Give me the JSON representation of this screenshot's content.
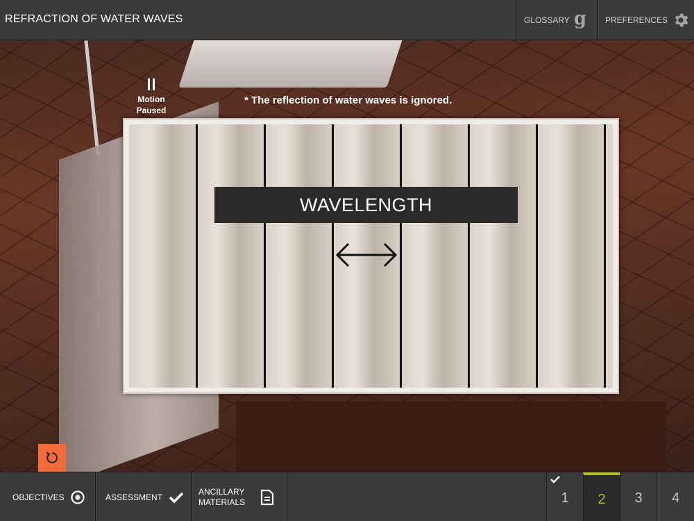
{
  "header": {
    "title": "REFRACTION OF WATER WAVES",
    "glossary_label": "GLOSSARY",
    "glossary_glyph": "g",
    "preferences_label": "PREFERENCES"
  },
  "simulation": {
    "motion_state_line1": "Motion",
    "motion_state_line2": "Paused",
    "note": "* The reflection of water waves is ignored.",
    "wavelength_label": "WAVELENGTH"
  },
  "footer": {
    "objectives_label": "OBJECTIVES",
    "assessment_label": "ASSESSMENT",
    "ancillary_line1": "ANCILLARY",
    "ancillary_line2": "MATERIALS",
    "pages": [
      {
        "label": "1",
        "completed": true
      },
      {
        "label": "2",
        "active": true
      },
      {
        "label": "3"
      },
      {
        "label": "4"
      }
    ]
  },
  "colors": {
    "accent_reset": "#f26b3a",
    "active_tab": "#b3bf2a"
  }
}
